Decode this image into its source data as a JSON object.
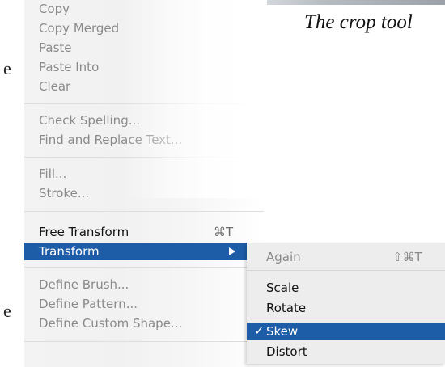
{
  "caption": "The crop tool",
  "page_edge": [
    "e",
    "e"
  ],
  "edit_menu": {
    "items": [
      {
        "label": "Copy",
        "enabled": false
      },
      {
        "label": "Copy Merged",
        "enabled": false
      },
      {
        "label": "Paste",
        "enabled": false
      },
      {
        "label": "Paste Into",
        "enabled": false
      },
      {
        "label": "Clear",
        "enabled": false
      },
      {
        "label": "Check Spelling...",
        "enabled": false
      },
      {
        "label": "Find and Replace Text...",
        "enabled": false
      },
      {
        "label": "Fill...",
        "enabled": false
      },
      {
        "label": "Stroke...",
        "enabled": false
      },
      {
        "label": "Free Transform",
        "enabled": true,
        "shortcut": "⌘T"
      },
      {
        "label": "Transform",
        "enabled": true,
        "highlighted": true
      },
      {
        "label": "Define Brush...",
        "enabled": false
      },
      {
        "label": "Define Pattern...",
        "enabled": false
      },
      {
        "label": "Define Custom Shape...",
        "enabled": false
      }
    ]
  },
  "transform_submenu": {
    "items": [
      {
        "label": "Again",
        "enabled": false,
        "shortcut": "⇧⌘T"
      },
      {
        "label": "Scale",
        "enabled": true
      },
      {
        "label": "Rotate",
        "enabled": true
      },
      {
        "label": "Skew",
        "enabled": true,
        "checked": true,
        "highlighted": true
      },
      {
        "label": "Distort",
        "enabled": true
      }
    ]
  },
  "colors": {
    "highlight": "#1d5da8",
    "menu_bg": "#f1f1f1",
    "disabled_text": "#8a8a8a"
  }
}
